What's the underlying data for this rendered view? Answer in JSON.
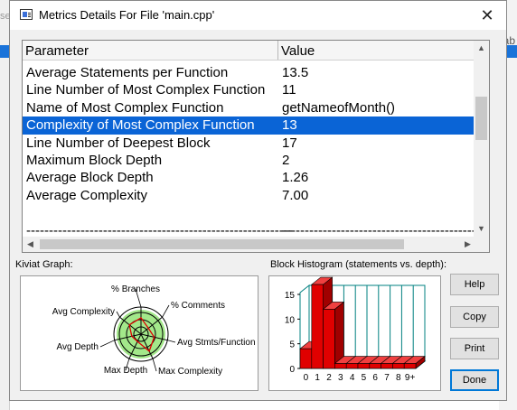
{
  "background": {
    "left_text": "se",
    "right_text": "ab"
  },
  "window": {
    "title": "Metrics Details For File 'main.cpp'",
    "close_label": "✕"
  },
  "metrics_table": {
    "columns": [
      "Parameter",
      "Value"
    ],
    "rows": [
      {
        "parameter": "Average Statements per Function",
        "value": "13.5",
        "selected": false
      },
      {
        "parameter": "Line Number of Most Complex Function",
        "value": "11",
        "selected": false
      },
      {
        "parameter": "Name of Most Complex Function",
        "value": "getNameofMonth()",
        "selected": false
      },
      {
        "parameter": "Complexity of Most Complex Function",
        "value": "13",
        "selected": true
      },
      {
        "parameter": "Line Number of Deepest Block",
        "value": "17",
        "selected": false
      },
      {
        "parameter": "Maximum Block Depth",
        "value": "2",
        "selected": false
      },
      {
        "parameter": "Average Block Depth",
        "value": "1.26",
        "selected": false
      },
      {
        "parameter": "Average Complexity",
        "value": "7.00",
        "selected": false
      },
      {
        "parameter": "",
        "value": "",
        "selected": false
      },
      {
        "parameter": "-----------------------------------------------------------",
        "value": "------------------------------------------------------",
        "selected": false
      }
    ]
  },
  "kiviat": {
    "label": "Kiviat Graph:",
    "axes": [
      "% Branches",
      "% Comments",
      "Avg Stmts/Function",
      "Max Complexity",
      "Max Depth",
      "Avg Depth",
      "Avg Complexity"
    ],
    "colors": {
      "zone": "#a3e88a",
      "line": "#000000",
      "value": "#e00000"
    }
  },
  "histogram": {
    "label": "Block Histogram (statements vs. depth):",
    "colors": {
      "bar": "#e00000",
      "grid": "#008080"
    }
  },
  "chart_data": {
    "type": "bar",
    "title": "Block Histogram (statements vs. depth):",
    "categories": [
      "0",
      "1",
      "2",
      "3",
      "4",
      "5",
      "6",
      "7",
      "8",
      "9+"
    ],
    "values": [
      4,
      17,
      12,
      1,
      1,
      1,
      1,
      1,
      1,
      1
    ],
    "ylim": [
      0,
      15
    ],
    "yticks": [
      0,
      5,
      10,
      15
    ],
    "grid": true,
    "legend": "none"
  },
  "buttons": {
    "help": "Help",
    "copy": "Copy",
    "print": "Print",
    "done": "Done"
  }
}
